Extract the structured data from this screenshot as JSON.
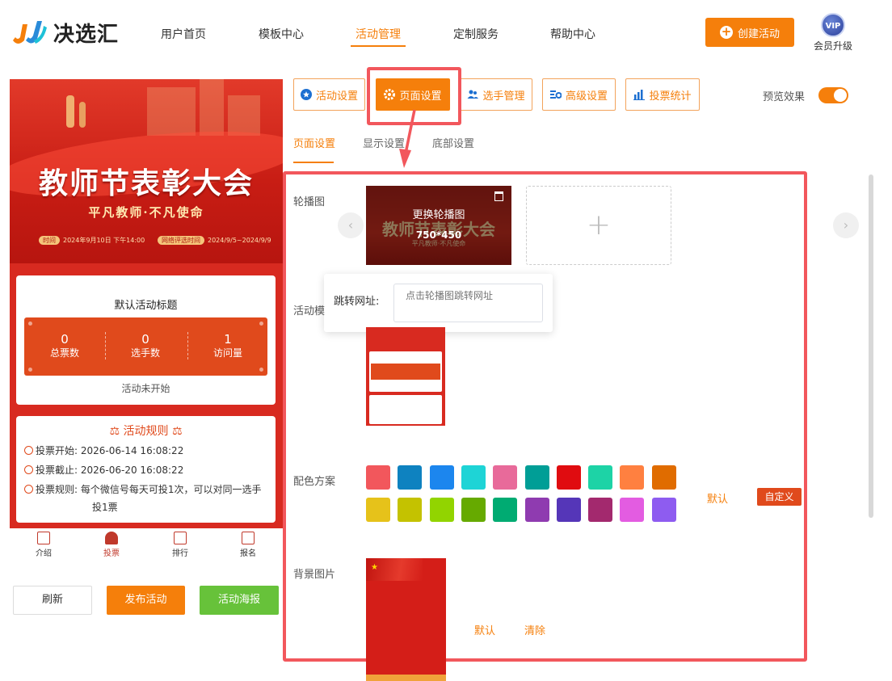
{
  "header": {
    "logo_text": "决选汇",
    "nav": [
      "用户首页",
      "模板中心",
      "活动管理",
      "定制服务",
      "帮助中心"
    ],
    "active_nav": "活动管理",
    "create_button": "创建活动",
    "vip_badge": "VIP",
    "vip_label": "会员升级"
  },
  "preview": {
    "banner_title": "教师节表彰大会",
    "banner_subtitle": "平凡教师·不凡使命",
    "meta_time_tag": "时间",
    "meta_time": "2024年9月10日 下午14:00",
    "meta_vote_tag": "网络评选时间",
    "meta_vote": "2024/9/5~2024/9/9",
    "card_title": "默认活动标题",
    "stats": [
      {
        "value": "0",
        "label": "总票数"
      },
      {
        "value": "0",
        "label": "选手数"
      },
      {
        "value": "1",
        "label": "访问量"
      }
    ],
    "status": "活动未开始",
    "rules_title": "活动规则",
    "rules": [
      {
        "label": "投票开始:",
        "value": "2026-06-14 16:08:22"
      },
      {
        "label": "投票截止:",
        "value": "2026-06-20 16:08:22"
      },
      {
        "label": "投票规则:",
        "value": "每个微信号每天可投1次，可以对同一选手"
      },
      {
        "label": "",
        "value": "投1票"
      }
    ],
    "tabs": [
      {
        "label": "介绍",
        "icon": "intro-icon"
      },
      {
        "label": "投票",
        "icon": "user-icon"
      },
      {
        "label": "排行",
        "icon": "ranking-icon"
      },
      {
        "label": "报名",
        "icon": "signup-icon"
      }
    ]
  },
  "actions": {
    "refresh": "刷新",
    "publish": "发布活动",
    "poster": "活动海报"
  },
  "toolbar": {
    "items": [
      {
        "label": "活动设置",
        "icon": "star-icon"
      },
      {
        "label": "页面设置",
        "icon": "gear-icon"
      },
      {
        "label": "选手管理",
        "icon": "users-icon"
      },
      {
        "label": "高级设置",
        "icon": "advanced-icon"
      },
      {
        "label": "投票统计",
        "icon": "chart-icon"
      }
    ],
    "active": "页面设置",
    "preview_label": "预览效果",
    "preview_on": true
  },
  "subtabs": {
    "items": [
      "页面设置",
      "显示设置",
      "底部设置"
    ],
    "active": "页面设置"
  },
  "page_settings": {
    "carousel_label": "轮播图",
    "carousel_replace": "更换轮播图",
    "carousel_size": "750*450",
    "carousel_thumb_title": "教师节表彰大会",
    "carousel_thumb_sub": "平凡教师·不凡使命",
    "link_label": "跳转网址:",
    "link_placeholder": "点击轮播图跳转网址",
    "template_label": "活动模",
    "color_label": "配色方案",
    "colors": [
      "#f2575c",
      "#0e82c0",
      "#1c86ee",
      "#1ed4d6",
      "#e86a9a",
      "#009e96",
      "#e00c10",
      "#1dd3a6",
      "#ff8040",
      "#e06c00",
      "#e6c21a",
      "#c4c200",
      "#92d400",
      "#66aa00",
      "#00ab72",
      "#8f3bb0",
      "#5536b8",
      "#a3296e",
      "#e35ce1",
      "#8e5cf0"
    ],
    "color_default": "默认",
    "color_custom": "自定义",
    "bg_label": "背景图片",
    "bg_default": "默认",
    "bg_clear": "清除"
  }
}
